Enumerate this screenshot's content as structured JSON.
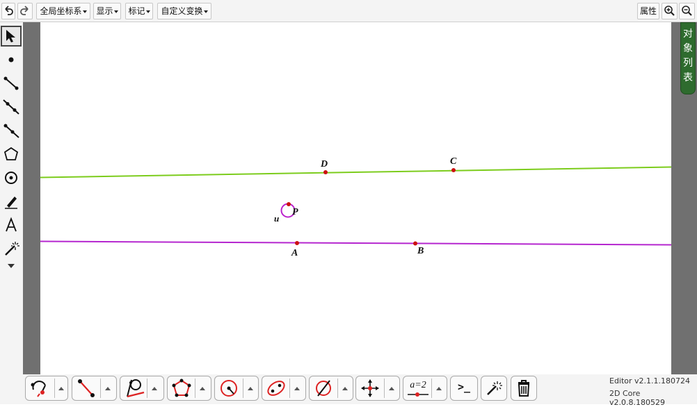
{
  "toolbar": {
    "menus": [
      "全局坐标系",
      "显示",
      "标记",
      "自定义变换"
    ],
    "properties_label": "属性"
  },
  "algebra_tab": {
    "label_chars": [
      "对",
      "象",
      "列",
      "表"
    ]
  },
  "canvas": {
    "colors": {
      "green_line": "#7ccc1c",
      "purple_line": "#b526cf",
      "point": "#cc1111",
      "circle": "#bb22cc"
    },
    "point_labels": {
      "D": "D",
      "C": "C",
      "P": "P",
      "A": "A",
      "B": "B",
      "u": "u"
    }
  },
  "bottom_tools": {
    "slider_label": "a=2",
    "input_label": ">_"
  },
  "version": {
    "editor": "Editor v2.1.1.180724",
    "core": "2D Core v2.0.8.180529"
  }
}
